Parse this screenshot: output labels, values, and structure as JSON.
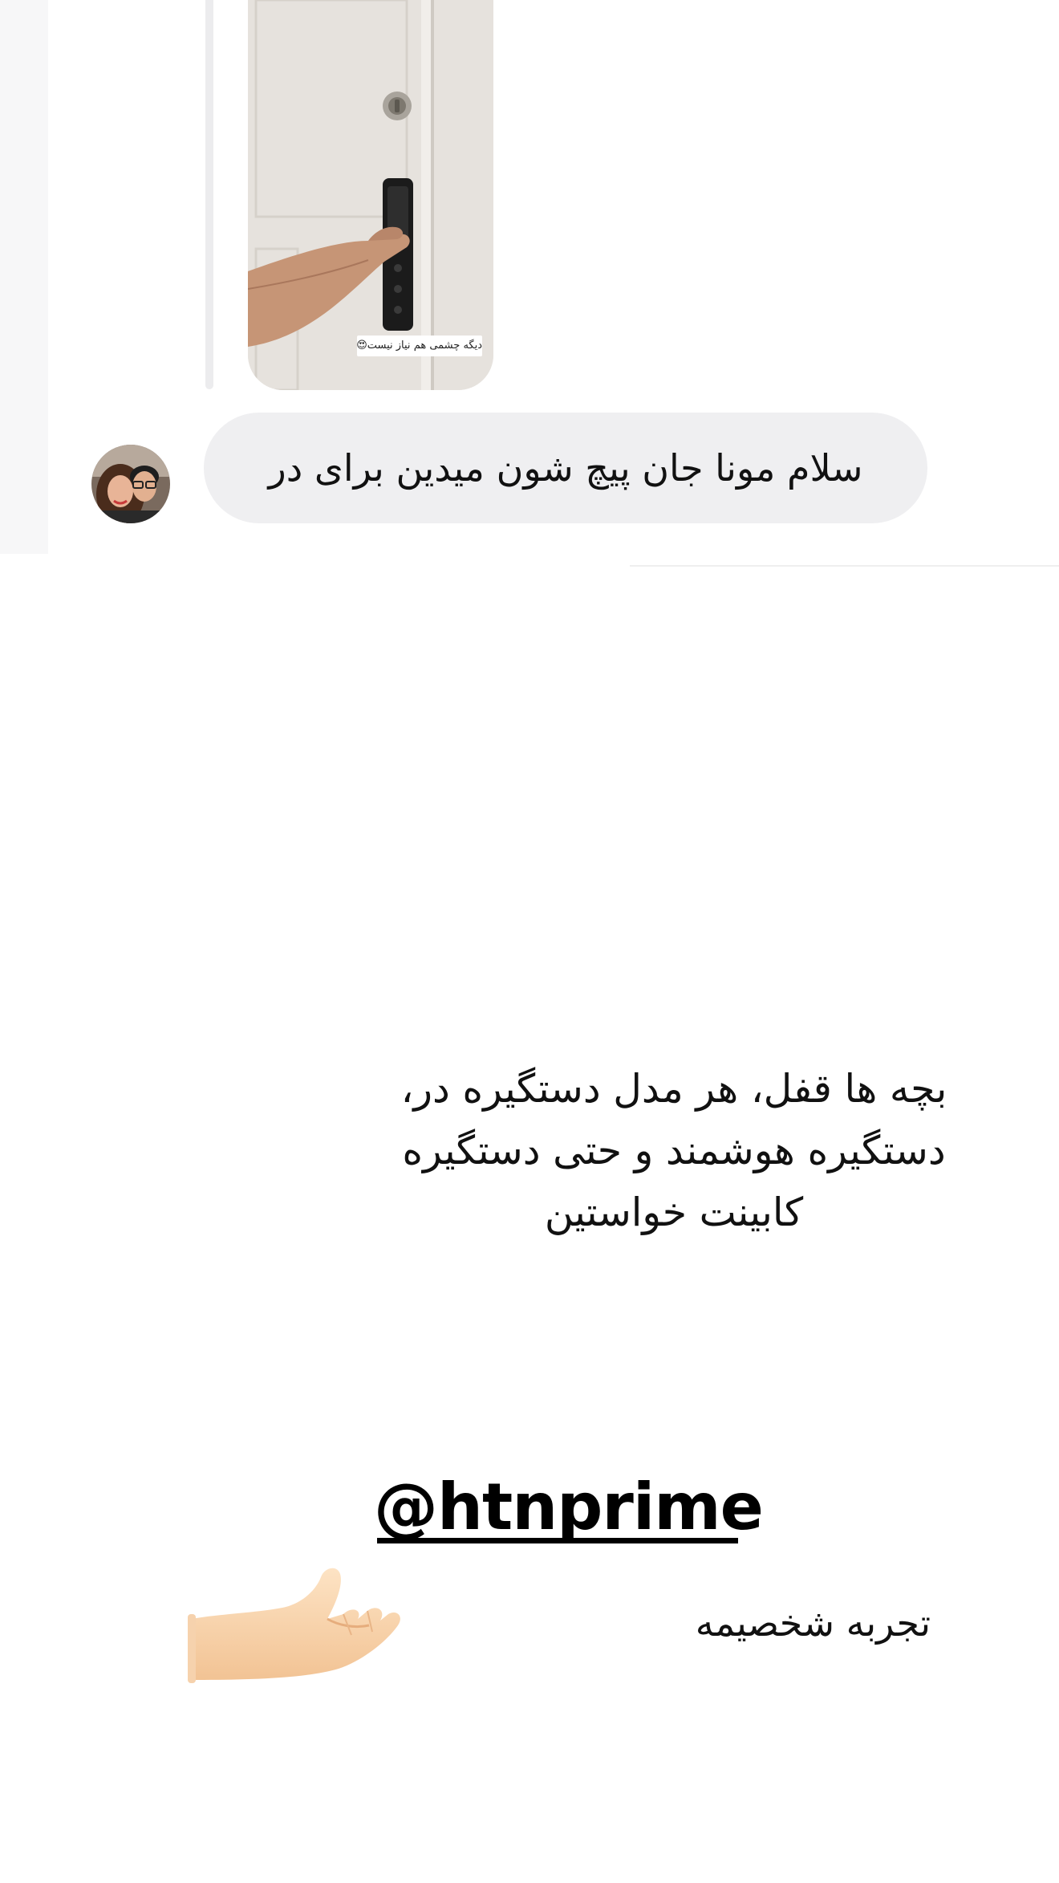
{
  "thread": {
    "shared_media": {
      "caption": "دیگه چشمی هم نیاز نیست😍"
    },
    "message": {
      "text": "سلام مونا جان پیچ شون میدین برای در"
    }
  },
  "story": {
    "text_lines": [
      "بچه ها قفل، هر مدل دستگیره در،",
      "دستگیره هوشمند و حتی دستگیره",
      "کابینت خواستین"
    ],
    "mention": "@htnprime",
    "experience_text": "تجربه شخصیمه"
  },
  "icons": {
    "hand": "palm-up-hand-icon",
    "avatar": "couple-avatar"
  },
  "colors": {
    "bubble": "#efeff1",
    "text": "#111111",
    "background": "#ffffff"
  }
}
